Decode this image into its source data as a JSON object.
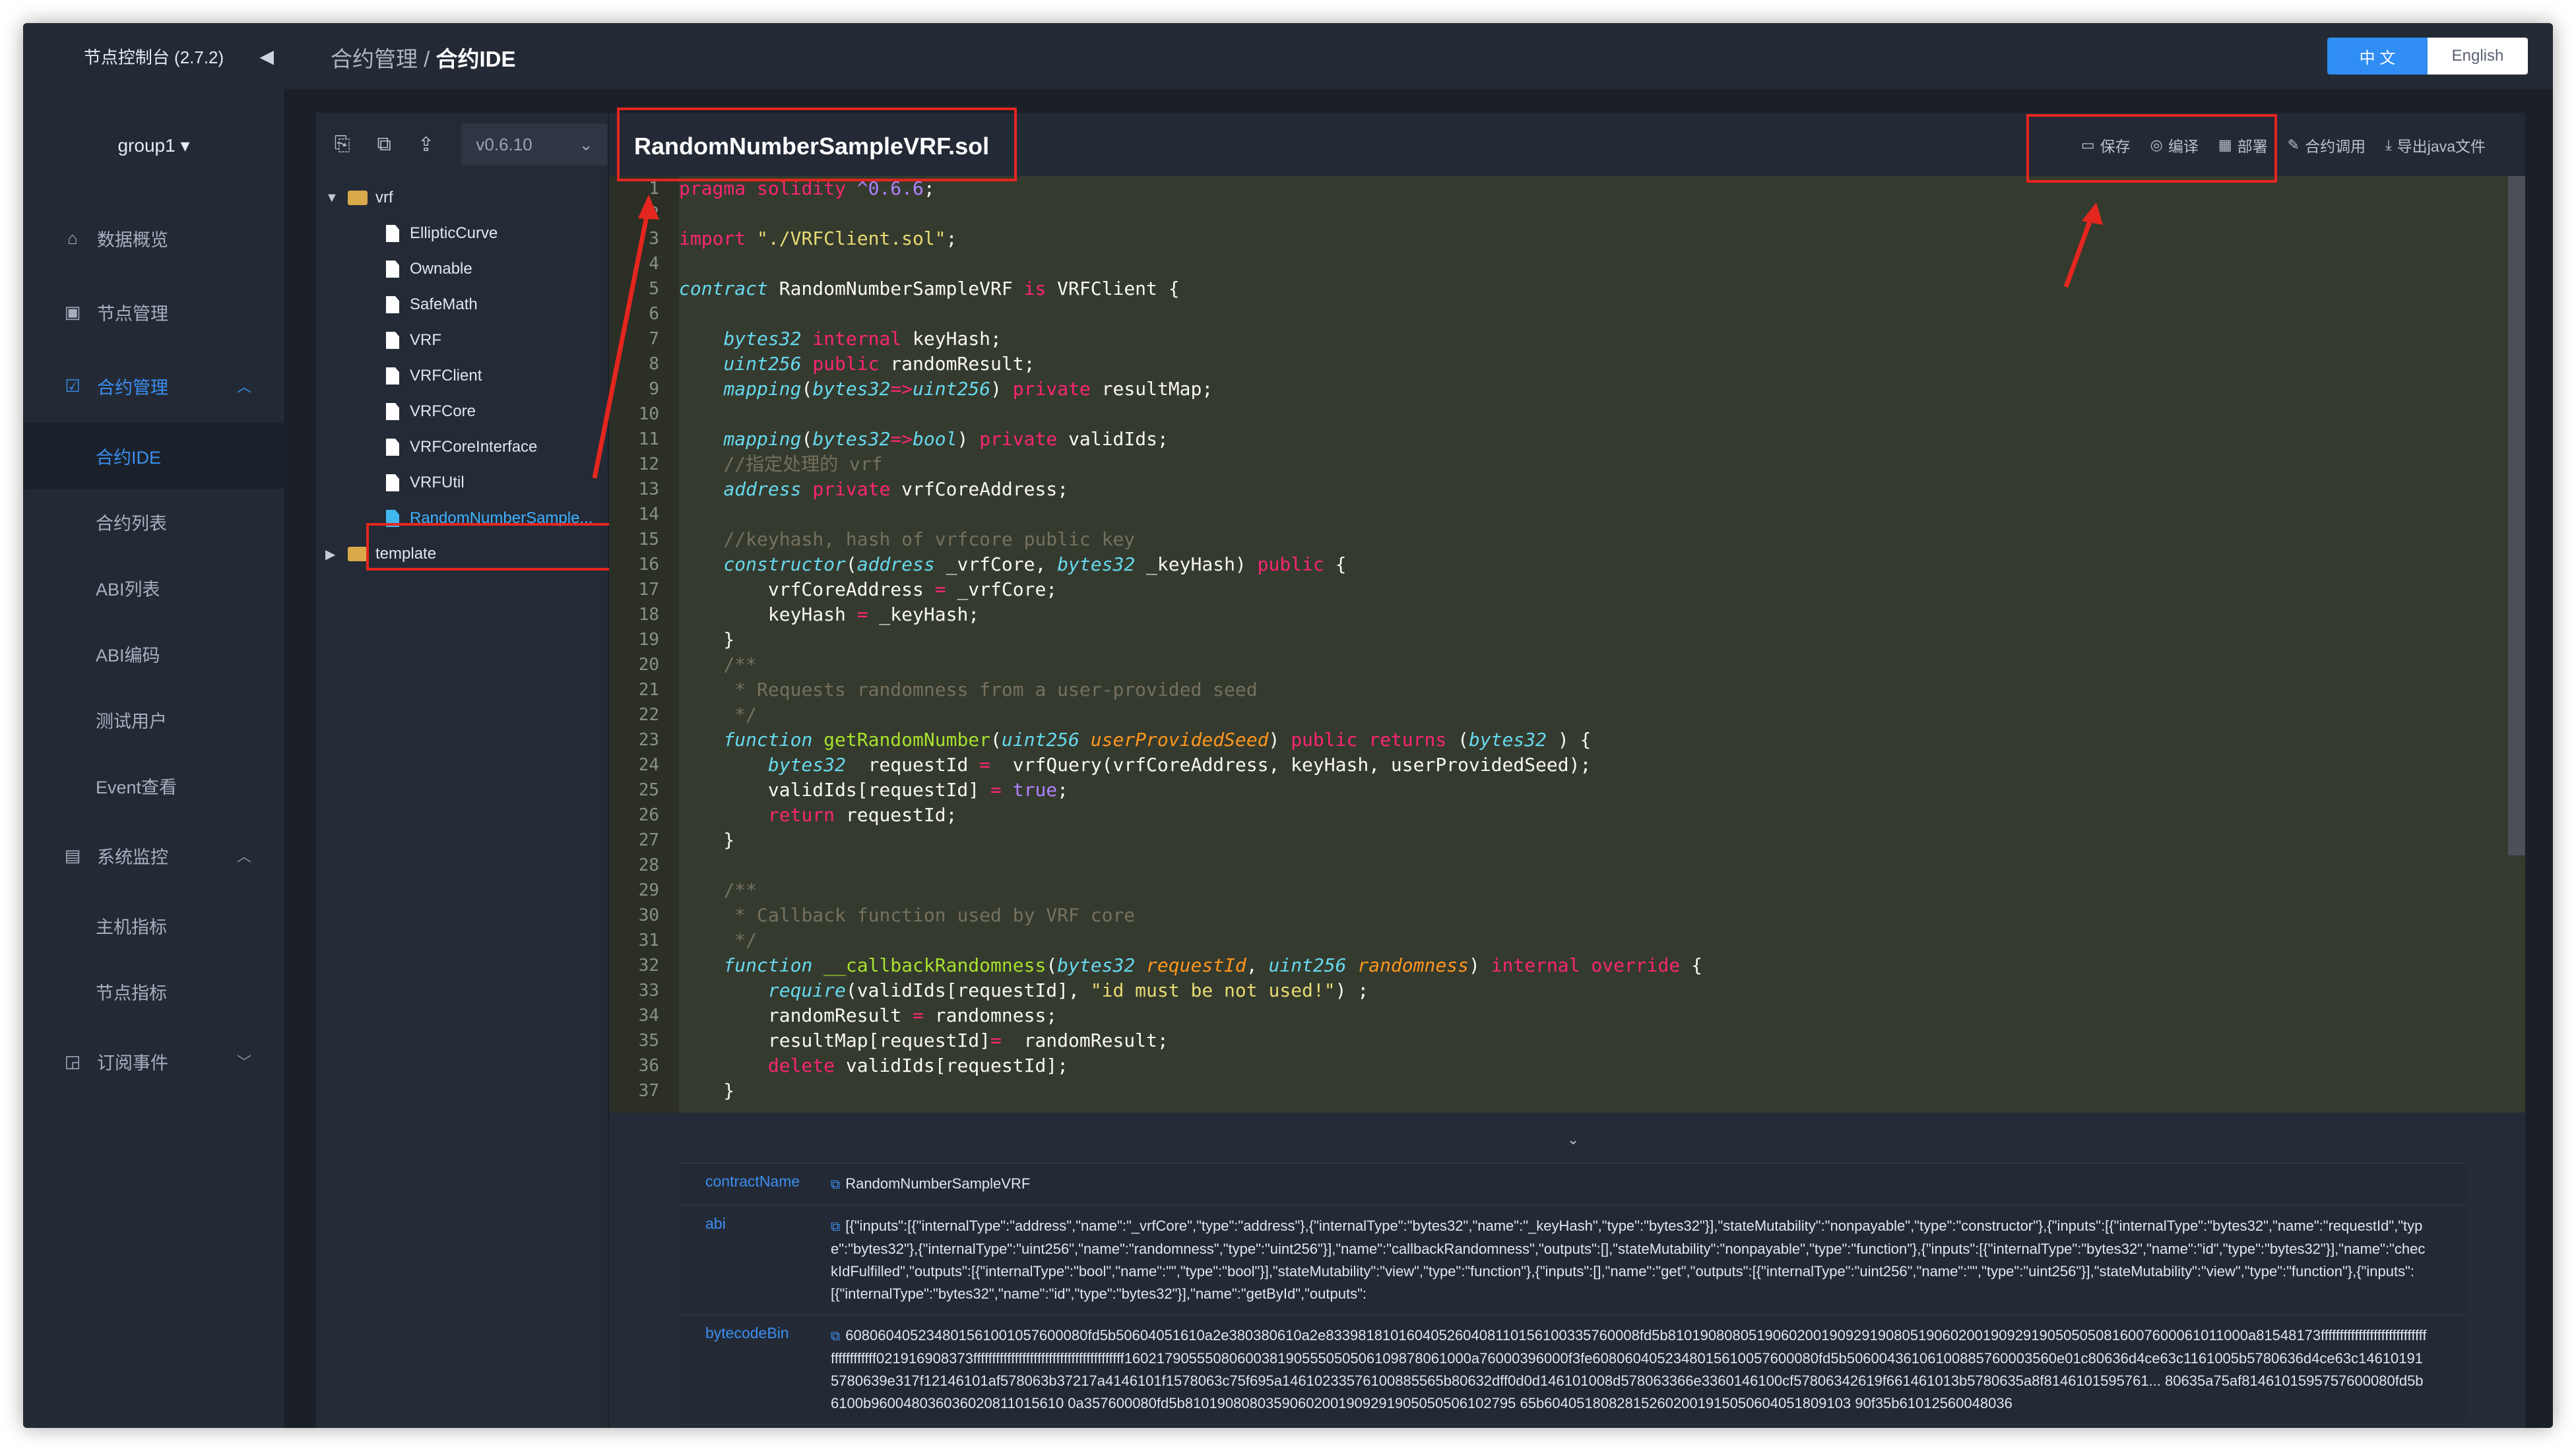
{
  "sidebar": {
    "title": "节点控制台 (2.7.2)",
    "collapse_icon": "◀",
    "group": "group1 ▾",
    "menu": [
      {
        "label": "数据概览",
        "icon": "home-icon"
      },
      {
        "label": "节点管理",
        "icon": "calendar-icon"
      },
      {
        "label": "合约管理",
        "icon": "clipboard-icon",
        "chevron": "︿"
      }
    ],
    "contract_sub": [
      "合约IDE",
      "合约列表",
      "ABI列表",
      "ABI编码",
      "测试用户",
      "Event查看"
    ],
    "monitor": {
      "label": "系统监控",
      "icon": "monitor-icon",
      "chevron": "︿"
    },
    "monitor_sub": [
      "主机指标",
      "节点指标"
    ],
    "subscribe": {
      "label": "订阅事件",
      "icon": "rss-icon",
      "chevron": "﹀"
    }
  },
  "header": {
    "breadcrumb_parent": "合约管理",
    "breadcrumb_sep": " / ",
    "breadcrumb_current": "合约IDE",
    "lang_zh": "中 文",
    "lang_en": "English"
  },
  "tree": {
    "version": "v0.6.10",
    "root_folder": "vrf",
    "files": [
      "EllipticCurve",
      "Ownable",
      "SafeMath",
      "VRF",
      "VRFClient",
      "VRFCore",
      "VRFCoreInterface",
      "VRFUtil",
      "RandomNumberSample..."
    ],
    "template_folder": "template"
  },
  "editor": {
    "filename": "RandomNumberSampleVRF.sol",
    "actions": {
      "save": "保存",
      "compile": "编译",
      "deploy": "部署",
      "call": "合约调用",
      "export": "导出java文件"
    },
    "line_numbers": [
      "1",
      "2",
      "3",
      "4",
      "5",
      "6",
      "7",
      "8",
      "9",
      "10",
      "11",
      "12",
      "13",
      "14",
      "15",
      "16",
      "17",
      "18",
      "19",
      "20",
      "21",
      "22",
      "23",
      "24",
      "25",
      "26",
      "27",
      "28",
      "29",
      "30",
      "31",
      "32",
      "33",
      "34",
      "35",
      "36",
      "37"
    ]
  },
  "output": {
    "toggle": "⌄",
    "contract_key": "contractName",
    "contract_value": "RandomNumberSampleVRF",
    "abi_key": "abi",
    "abi_value": "[{\"inputs\":[{\"internalType\":\"address\",\"name\":\"_vrfCore\",\"type\":\"address\"},{\"internalType\":\"bytes32\",\"name\":\"_keyHash\",\"type\":\"bytes32\"}],\"stateMutability\":\"nonpayable\",\"type\":\"constructor\"},{\"inputs\":[{\"internalType\":\"bytes32\",\"name\":\"requestId\",\"type\":\"bytes32\"},{\"internalType\":\"uint256\",\"name\":\"randomness\",\"type\":\"uint256\"}],\"name\":\"callbackRandomness\",\"outputs\":[],\"stateMutability\":\"nonpayable\",\"type\":\"function\"},{\"inputs\":[{\"internalType\":\"bytes32\",\"name\":\"id\",\"type\":\"bytes32\"}],\"name\":\"checkIdFulfilled\",\"outputs\":[{\"internalType\":\"bool\",\"name\":\"\",\"type\":\"bool\"}],\"stateMutability\":\"view\",\"type\":\"function\"},{\"inputs\":[],\"name\":\"get\",\"outputs\":[{\"internalType\":\"uint256\",\"name\":\"\",\"type\":\"uint256\"}],\"stateMutability\":\"view\",\"type\":\"function\"},{\"inputs\":[{\"internalType\":\"bytes32\",\"name\":\"id\",\"type\":\"bytes32\"}],\"name\":\"getById\",\"outputs\":",
    "bytecode_key": "bytecodeBin",
    "bytecode_value": "608060405234801561001057600080fd5b50604051610a2e380380610a2e833981810160405260408110156100335760008fd5b810190808051906020019092919080519060200190929190505050816007600061011000a81548173ffffffffffffffffffffffffffffffffffffffff021916908373ffffffffffffffffffffffffffffffffffffffff1602179055508060038190555050506109878061000a76000396000f3fe6080604052348015610057600080fd5b50600436106100885760003560e01c80636d4ce63c1161005b5780636d4ce63c146101915780639e317f12146101af578063b37217a4146101f1578063c75f695a14610233576100885565b80632dff0d0d146101008d578063366e3360146100cf57806342619f661461013b5780635a8f8146101595761... 80635a75af8146101595757600080fd5b6100b960048036036020811015610 0a357600080fd5b81019080803590602001909291905050506102795 65b60405180828152602001915050604051809103 90f35b61012560048036"
  }
}
